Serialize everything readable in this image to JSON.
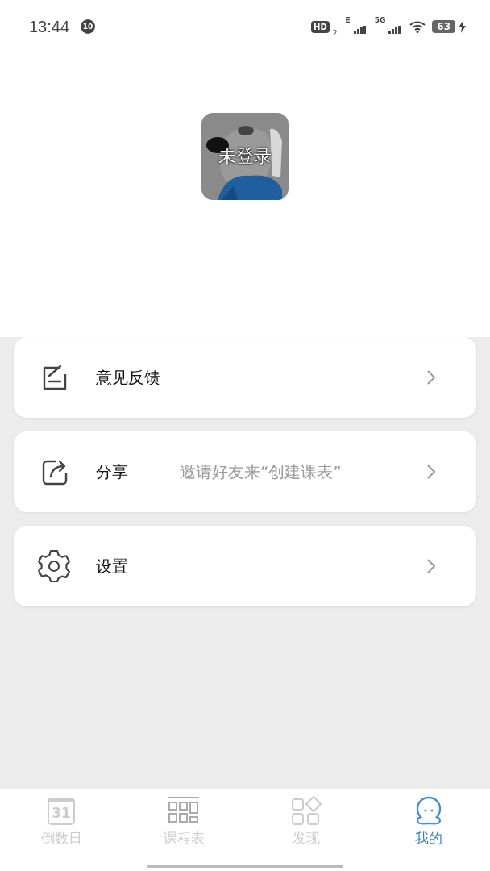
{
  "status_bar": {
    "time": "13:44",
    "notification_badge": "10",
    "hd_label": "HD",
    "sim_number": "2",
    "network_1": "E",
    "network_2": "5G",
    "battery": "63"
  },
  "profile": {
    "login_status": "未登录"
  },
  "menu": [
    {
      "kind": "feedback",
      "label": "意见反馈"
    },
    {
      "kind": "share",
      "label": "分享",
      "hint": "邀请好友来“创建课表”"
    },
    {
      "kind": "settings",
      "label": "设置"
    }
  ],
  "tabs": [
    {
      "kind": "calendar",
      "label": "倒数日",
      "icon_text": "31",
      "selected": false
    },
    {
      "kind": "timetable",
      "label": "课程表",
      "selected": false
    },
    {
      "kind": "discover",
      "label": "发现",
      "selected": false
    },
    {
      "kind": "me",
      "label": "我的",
      "selected": true
    }
  ]
}
